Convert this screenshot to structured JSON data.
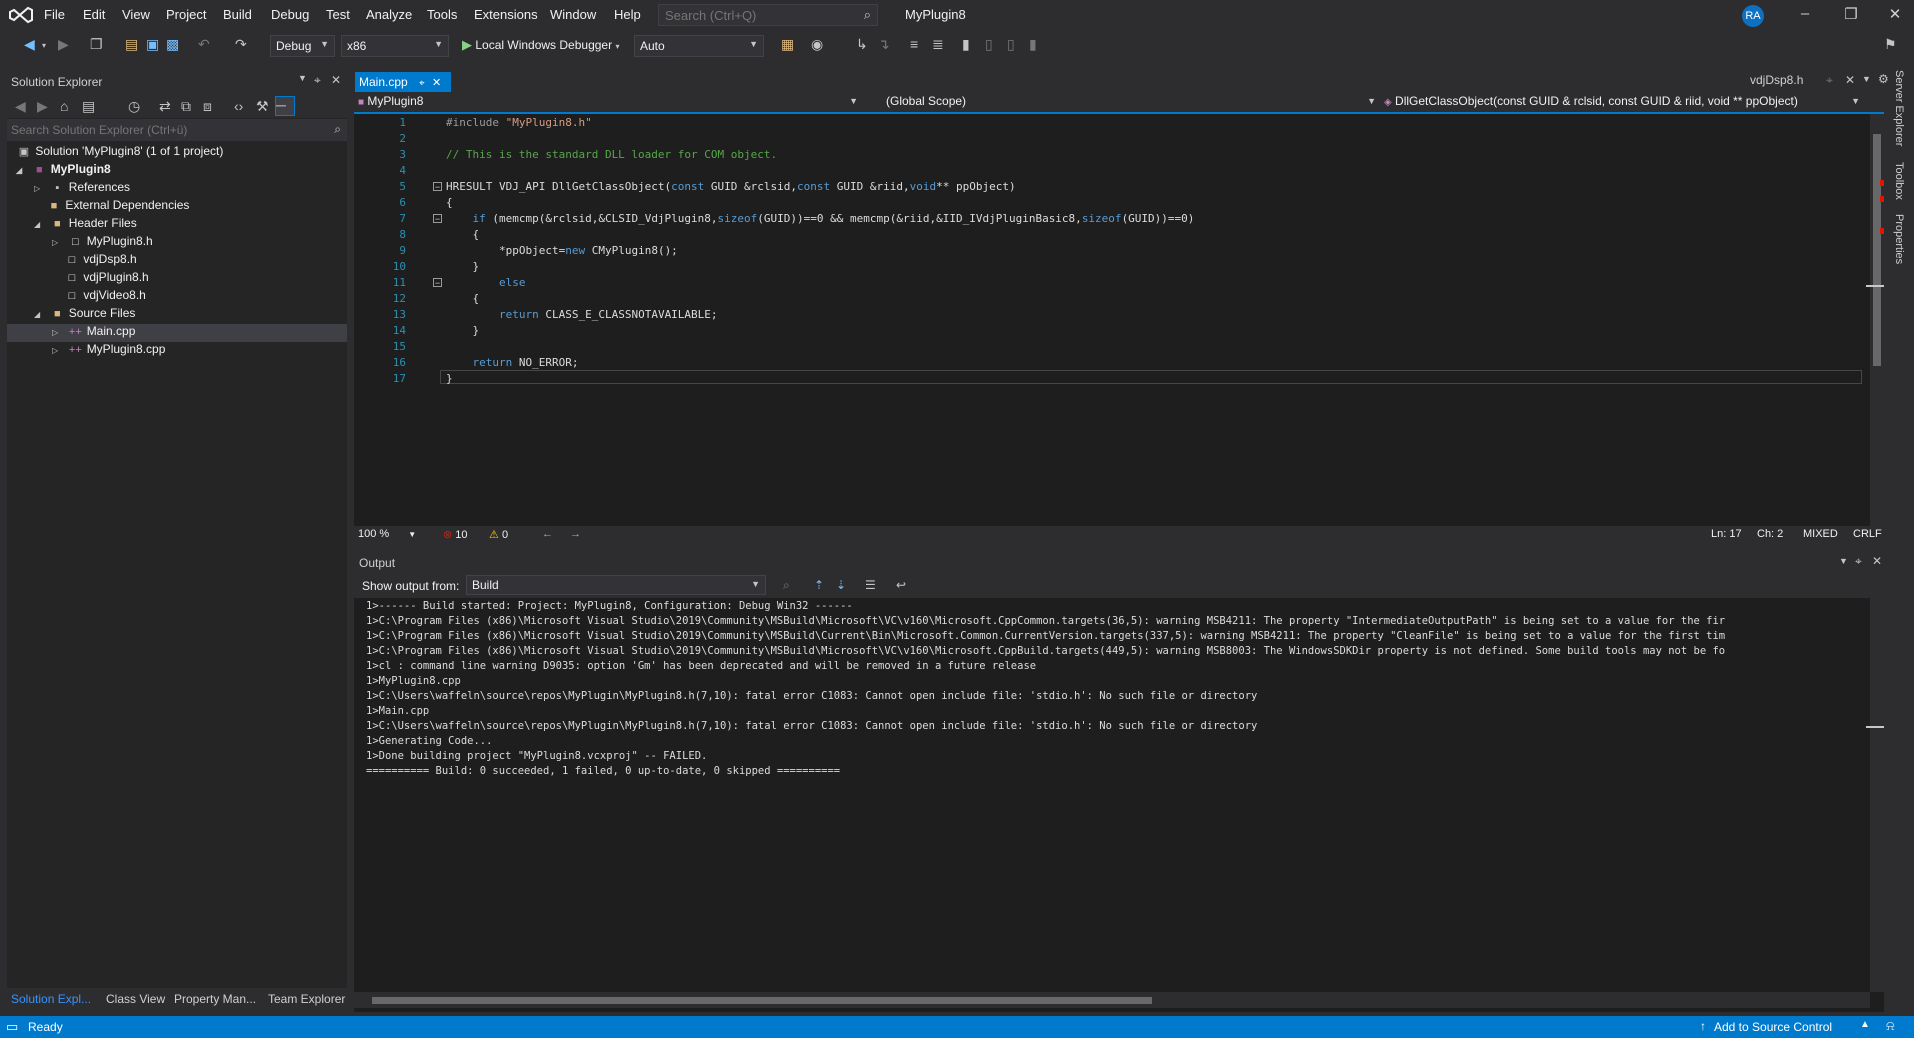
{
  "menu": [
    "File",
    "Edit",
    "View",
    "Project",
    "Build",
    "Debug",
    "Test",
    "Analyze",
    "Tools",
    "Extensions",
    "Window",
    "Help"
  ],
  "search": {
    "placeholder": "Search (Ctrl+Q)"
  },
  "window_title": "MyPlugin8",
  "user_initials": "RA",
  "toolbar": {
    "configuration": "Debug",
    "platform": "x86",
    "debugger_label": "Local Windows Debugger",
    "debugger_mode": "Auto"
  },
  "solution_explorer": {
    "title": "Solution Explorer",
    "search_placeholder": "Search Solution Explorer (Ctrl+ü)",
    "tree": [
      {
        "label": "Solution 'MyPlugin8' (1 of 1 project)"
      },
      {
        "label": "MyPlugin8"
      },
      {
        "label": "References"
      },
      {
        "label": "External Dependencies"
      },
      {
        "label": "Header Files"
      },
      {
        "label": "MyPlugin8.h"
      },
      {
        "label": "vdjDsp8.h"
      },
      {
        "label": "vdjPlugin8.h"
      },
      {
        "label": "vdjVideo8.h"
      },
      {
        "label": "Source Files"
      },
      {
        "label": "Main.cpp"
      },
      {
        "label": "MyPlugin8.cpp"
      }
    ],
    "tabs": [
      "Solution Expl...",
      "Class View",
      "Property Man...",
      "Team Explorer"
    ]
  },
  "editor": {
    "active_tab": "Main.cpp",
    "other_tab": "vdjDsp8.h",
    "nav_project": "MyPlugin8",
    "nav_scope": "(Global Scope)",
    "nav_member": "DllGetClassObject(const GUID & rclsid, const GUID & riid, void ** ppObject)",
    "zoom": "100 %",
    "errors": "10",
    "warnings": "0",
    "ln": "Ln: 17",
    "ch": "Ch: 2",
    "tabs_mode": "MIXED",
    "line_ending": "CRLF",
    "lines": [
      {
        "n": "1",
        "text": "#include \"MyPlugin8.h\""
      },
      {
        "n": "2",
        "text": ""
      },
      {
        "n": "3",
        "text": "// This is the standard DLL loader for COM object."
      },
      {
        "n": "4",
        "text": ""
      },
      {
        "n": "5",
        "text": "HRESULT VDJ_API DllGetClassObject(const GUID &rclsid,const GUID &riid,void** ppObject)"
      },
      {
        "n": "6",
        "text": "{"
      },
      {
        "n": "7",
        "text": "    if (memcmp(&rclsid,&CLSID_VdjPlugin8,sizeof(GUID))==0 && memcmp(&riid,&IID_IVdjPluginBasic8,sizeof(GUID))==0)"
      },
      {
        "n": "8",
        "text": "    {"
      },
      {
        "n": "9",
        "text": "        *ppObject=new CMyPlugin8();"
      },
      {
        "n": "10",
        "text": "    }"
      },
      {
        "n": "11",
        "text": "        else"
      },
      {
        "n": "12",
        "text": "    {"
      },
      {
        "n": "13",
        "text": "        return CLASS_E_CLASSNOTAVAILABLE;"
      },
      {
        "n": "14",
        "text": "    }"
      },
      {
        "n": "15",
        "text": ""
      },
      {
        "n": "16",
        "text": "    return NO_ERROR;"
      },
      {
        "n": "17",
        "text": "}"
      }
    ]
  },
  "output": {
    "title": "Output",
    "show_from_label": "Show output from:",
    "source": "Build",
    "lines": [
      "1>------ Build started: Project: MyPlugin8, Configuration: Debug Win32 ------",
      "1>C:\\Program Files (x86)\\Microsoft Visual Studio\\2019\\Community\\MSBuild\\Microsoft\\VC\\v160\\Microsoft.CppCommon.targets(36,5): warning MSB4211: The property \"IntermediateOutputPath\" is being set to a value for the fir",
      "1>C:\\Program Files (x86)\\Microsoft Visual Studio\\2019\\Community\\MSBuild\\Current\\Bin\\Microsoft.Common.CurrentVersion.targets(337,5): warning MSB4211: The property \"CleanFile\" is being set to a value for the first tim",
      "1>C:\\Program Files (x86)\\Microsoft Visual Studio\\2019\\Community\\MSBuild\\Microsoft\\VC\\v160\\Microsoft.CppBuild.targets(449,5): warning MSB8003: The WindowsSDKDir property is not defined. Some build tools may not be fo",
      "1>cl : command line warning D9035: option 'Gm' has been deprecated and will be removed in a future release",
      "1>MyPlugin8.cpp",
      "1>C:\\Users\\waffeln\\source\\repos\\MyPlugin\\MyPlugin8.h(7,10): fatal error C1083: Cannot open include file: 'stdio.h': No such file or directory",
      "1>Main.cpp",
      "1>C:\\Users\\waffeln\\source\\repos\\MyPlugin\\MyPlugin8.h(7,10): fatal error C1083: Cannot open include file: 'stdio.h': No such file or directory",
      "1>Generating Code...",
      "1>Done building project \"MyPlugin8.vcxproj\" -- FAILED.",
      "========== Build: 0 succeeded, 1 failed, 0 up-to-date, 0 skipped =========="
    ]
  },
  "side_tabs": [
    "Server Explorer",
    "Toolbox",
    "Properties"
  ],
  "status": {
    "ready": "Ready",
    "source_control": "Add to Source Control"
  },
  "colors": {
    "accent": "#007acc",
    "background": "#1e1e1e",
    "chrome": "#2d2d30",
    "error": "#e51400",
    "warning": "#ffcc00"
  }
}
